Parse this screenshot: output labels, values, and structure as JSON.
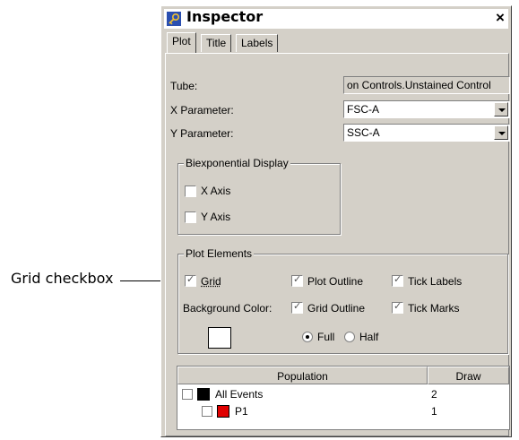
{
  "callout": {
    "label": "Grid checkbox"
  },
  "window": {
    "title": "Inspector",
    "close_glyph": "×",
    "icon": "inspector-key-icon"
  },
  "tabs": [
    {
      "label": "Plot",
      "active": true
    },
    {
      "label": "Title"
    },
    {
      "label": "Labels"
    }
  ],
  "fields": {
    "tube": {
      "label": "Tube:",
      "value": "on Controls.Unstained Control"
    },
    "x_param": {
      "label": "X Parameter:",
      "value": "FSC-A"
    },
    "y_param": {
      "label": "Y Parameter:",
      "value": "SSC-A"
    }
  },
  "biexp": {
    "title": "Biexponential Display",
    "x_axis": "X Axis",
    "y_axis": "Y Axis"
  },
  "plot_elements": {
    "title": "Plot Elements",
    "grid": "Grid",
    "plot_outline": "Plot Outline",
    "tick_labels": "Tick Labels",
    "bg_color_label": "Background Color:",
    "grid_outline": "Grid Outline",
    "tick_marks": "Tick Marks",
    "full": "Full",
    "half": "Half",
    "bg_color": "#ffffff"
  },
  "population_table": {
    "headers": {
      "population": "Population",
      "draw": "Draw"
    },
    "rows": [
      {
        "name": "All Events",
        "draw": "2",
        "color": "#000000"
      },
      {
        "name": "P1",
        "draw": "1",
        "color": "#e00000"
      }
    ]
  }
}
